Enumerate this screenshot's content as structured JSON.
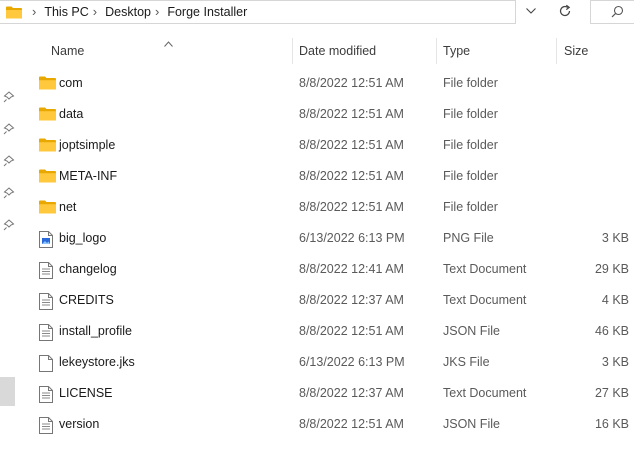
{
  "address": {
    "crumbs": [
      "This PC",
      "Desktop",
      "Forge Installer"
    ],
    "separator": "›"
  },
  "columns": {
    "name": "Name",
    "date": "Date modified",
    "type": "Type",
    "size": "Size"
  },
  "files": [
    {
      "name": "com",
      "date": "8/8/2022 12:51 AM",
      "type": "File folder",
      "size": "",
      "icon": "folder-icon"
    },
    {
      "name": "data",
      "date": "8/8/2022 12:51 AM",
      "type": "File folder",
      "size": "",
      "icon": "folder-icon"
    },
    {
      "name": "joptsimple",
      "date": "8/8/2022 12:51 AM",
      "type": "File folder",
      "size": "",
      "icon": "folder-icon"
    },
    {
      "name": "META-INF",
      "date": "8/8/2022 12:51 AM",
      "type": "File folder",
      "size": "",
      "icon": "folder-icon"
    },
    {
      "name": "net",
      "date": "8/8/2022 12:51 AM",
      "type": "File folder",
      "size": "",
      "icon": "folder-icon"
    },
    {
      "name": "big_logo",
      "date": "6/13/2022 6:13 PM",
      "type": "PNG File",
      "size": "3 KB",
      "icon": "image-file-icon"
    },
    {
      "name": "changelog",
      "date": "8/8/2022 12:41 AM",
      "type": "Text Document",
      "size": "29 KB",
      "icon": "text-file-icon"
    },
    {
      "name": "CREDITS",
      "date": "8/8/2022 12:37 AM",
      "type": "Text Document",
      "size": "4 KB",
      "icon": "text-file-icon"
    },
    {
      "name": "install_profile",
      "date": "8/8/2022 12:51 AM",
      "type": "JSON File",
      "size": "46 KB",
      "icon": "text-file-icon"
    },
    {
      "name": "lekeystore.jks",
      "date": "6/13/2022 6:13 PM",
      "type": "JKS File",
      "size": "3 KB",
      "icon": "blank-file-icon"
    },
    {
      "name": "LICENSE",
      "date": "8/8/2022 12:37 AM",
      "type": "Text Document",
      "size": "27 KB",
      "icon": "text-file-icon"
    },
    {
      "name": "version",
      "date": "8/8/2022 12:51 AM",
      "type": "JSON File",
      "size": "16 KB",
      "icon": "text-file-icon"
    }
  ],
  "colors": {
    "folder_yellow": "#ffc83d",
    "folder_dark": "#e8a800",
    "muted_text": "#5a5a5a",
    "border": "#d6d6d6"
  }
}
